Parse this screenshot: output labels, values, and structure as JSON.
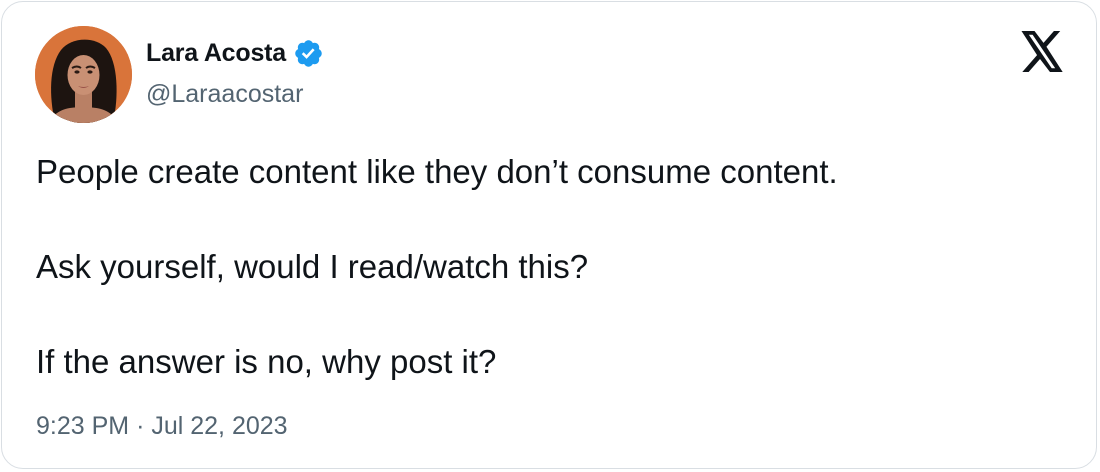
{
  "author": {
    "name": "Lara Acosta",
    "handle": "@Laraacostar",
    "verified": true
  },
  "tweet": {
    "lines": [
      "People create content like they don’t consume content.",
      "Ask yourself, would I read/watch this?",
      "If the answer is no, why post it?"
    ]
  },
  "meta": {
    "time": "9:23 PM",
    "separator": "·",
    "date": "Jul 22, 2023"
  },
  "icons": {
    "brand_logo": "x-logo-icon",
    "verified": "verified-badge-icon"
  },
  "colors": {
    "text_primary": "#0f1419",
    "text_secondary": "#536471",
    "verified_blue": "#1d9bf0",
    "border": "#d9dee3"
  }
}
